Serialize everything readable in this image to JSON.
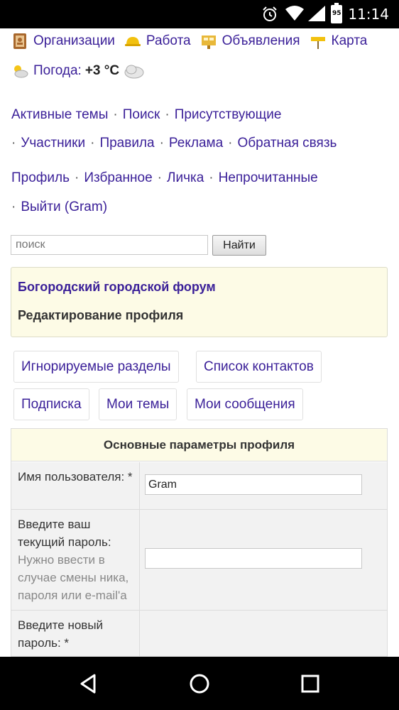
{
  "status_bar": {
    "time": "11:14",
    "battery": "95"
  },
  "top_nav": {
    "items": [
      {
        "label": "Организации",
        "icon": "organizations-icon"
      },
      {
        "label": "Работа",
        "icon": "work-helmet-icon"
      },
      {
        "label": "Объявления",
        "icon": "ads-icon"
      },
      {
        "label": "Карта",
        "icon": "map-sign-icon"
      }
    ],
    "weather": {
      "label": "Погода:",
      "value": "+3 °C"
    }
  },
  "links": {
    "row1": [
      "Активные темы",
      "Поиск",
      "Присутствующие"
    ],
    "row2": [
      "Участники",
      "Правила",
      "Реклама",
      "Обратная связь"
    ],
    "row3": [
      "Профиль",
      "Избранное",
      "Личка",
      "Непрочитанные"
    ],
    "row4": [
      "Выйти (Gram)"
    ]
  },
  "search": {
    "placeholder": "поиск",
    "button": "Найти"
  },
  "forum": {
    "name": "Богородский городской форум",
    "page_title": "Редактирование профиля"
  },
  "tabs": [
    "Игнорируемые разделы",
    "Список контактов",
    "Подписка",
    "Мои темы",
    "Мои сообщения"
  ],
  "profile_table": {
    "header": "Основные параметры профиля",
    "rows": [
      {
        "label": "Имя пользователя: *",
        "hint": "",
        "value": "Gram"
      },
      {
        "label": "Введите ваш текущий пароль:",
        "hint": "Нужно ввести в случае смены ника, пароля или e-mail'а",
        "value": ""
      },
      {
        "label": "Введите новый пароль: *",
        "hint": ""
      }
    ]
  },
  "colors": {
    "link": "#3a1f98",
    "panel": "#fdfbe6"
  }
}
